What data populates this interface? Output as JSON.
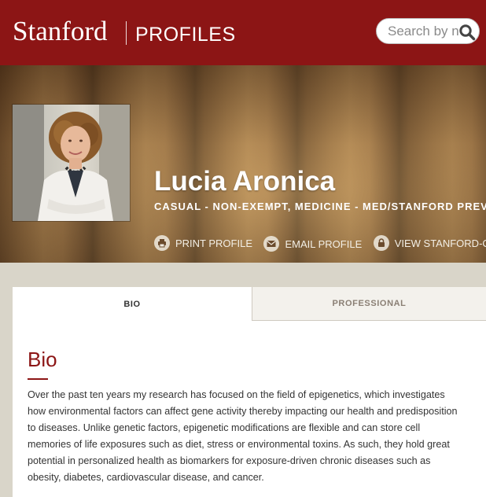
{
  "header": {
    "brand": "Stanford",
    "section": "PROFILES",
    "search_placeholder": "Search by name",
    "search_icon": "search-icon",
    "colors": {
      "cardinal": "#8c1515",
      "white": "#ffffff"
    }
  },
  "profile": {
    "name": "Lucia Aronica",
    "title": "CASUAL - NON-EXEMPT, MEDICINE - MED/STANFORD PREVENTION RESEARCH CENTER",
    "actions": [
      {
        "label": "PRINT PROFILE",
        "icon": "printer-icon"
      },
      {
        "label": "EMAIL PROFILE",
        "icon": "envelope-icon"
      },
      {
        "label": "VIEW STANFORD-ONLY PROFILE",
        "icon": "lock-icon"
      }
    ]
  },
  "tabs": [
    {
      "label": "BIO",
      "active": true
    },
    {
      "label": "PROFESSIONAL",
      "active": false
    }
  ],
  "bio": {
    "heading": "Bio",
    "text": "Over the past ten years my research has focused on the field of epigenetics, which investigates how environmental factors can affect gene activity thereby impacting our health and predisposition to diseases. Unlike genetic factors, epigenetic modifications are flexible and can store cell memories of life exposures such as diet, stress or environmental toxins. As such, they hold great potential in personalized health as biomarkers for exposure-driven chronic diseases such as obesity, diabetes, cardiovascular disease, and cancer."
  }
}
